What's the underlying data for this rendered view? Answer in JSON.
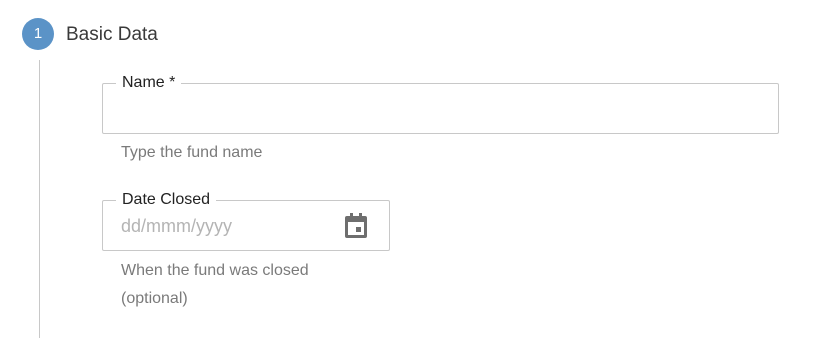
{
  "step": {
    "number": "1",
    "title": "Basic Data"
  },
  "name_field": {
    "label": "Name *",
    "value": "",
    "helper": "Type the fund name"
  },
  "date_closed_field": {
    "label": "Date Closed",
    "placeholder": "dd/mmm/yyyy",
    "helper": "When the fund was closed (optional)",
    "icon": "calendar-icon"
  },
  "colors": {
    "step_accent": "#5b93c7",
    "border": "#c8c8c8",
    "helper_text": "#7a7a7a",
    "placeholder_text": "#b4b4b4"
  }
}
